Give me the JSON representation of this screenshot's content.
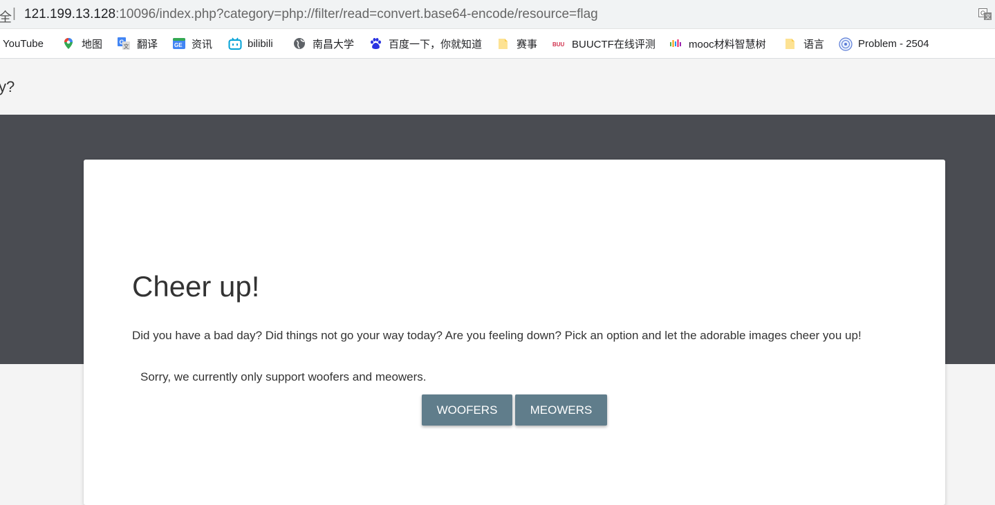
{
  "addressbar": {
    "security_label": "全",
    "separator": "|",
    "url_host": "121.199.13.128",
    "url_rest": ":10096/index.php?category=php://filter/read=convert.base64-encode/resource=flag"
  },
  "bookmarks": [
    {
      "label": "YouTube",
      "icon": "youtube-icon"
    },
    {
      "label": "地图",
      "icon": "maps-pin-icon"
    },
    {
      "label": "翻译",
      "icon": "google-translate-icon"
    },
    {
      "label": "资讯",
      "icon": "google-news-icon"
    },
    {
      "label": "bilibili",
      "icon": "bilibili-icon"
    },
    {
      "label": "南昌大学",
      "icon": "globe-icon"
    },
    {
      "label": "百度一下，你就知道",
      "icon": "baidu-paw-icon"
    },
    {
      "label": "赛事",
      "icon": "folder-icon"
    },
    {
      "label": "BUUCTF在线评测",
      "icon": "buuctf-icon"
    },
    {
      "label": "mooc材料智慧树",
      "icon": "mooc-icon"
    },
    {
      "label": "语言",
      "icon": "folder-icon"
    },
    {
      "label": "Problem - 2504",
      "icon": "hdu-logo-icon"
    }
  ],
  "page": {
    "prev_text": "y?",
    "heading": "Cheer up!",
    "intro": "Did you have a bad day? Did things not go your way today? Are you feeling down? Pick an option and let the adorable images cheer you up!",
    "notice": "Sorry, we currently only support woofers and meowers.",
    "buttons": {
      "woofers": "WOOFERS",
      "meowers": "MEOWERS"
    }
  },
  "colors": {
    "hero_bg": "#4a4c52",
    "button_bg": "#607d8b",
    "card_bg": "#ffffff",
    "page_bg": "#f4f4f4"
  }
}
